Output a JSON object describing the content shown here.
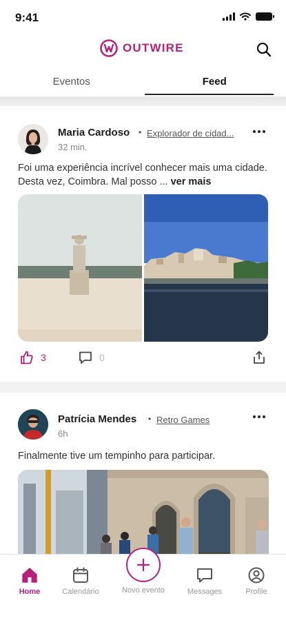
{
  "status_bar": {
    "time": "9:41"
  },
  "header": {
    "logo_text": "OUTWIRE",
    "brand_color": "#b5217a",
    "logo_icon": "outwire-logo-icon",
    "search_icon": "search-icon"
  },
  "tabs": [
    {
      "label": "Eventos",
      "active": false
    },
    {
      "label": "Feed",
      "active": true
    }
  ],
  "feed": {
    "posts": [
      {
        "author": "Maria Cardoso",
        "group": "Explorador de cidad...",
        "time": "32 min.",
        "text": "Foi uma experiência incrível conhecer mais uma cidade. Desta vez, Coimbra. Mal posso ...",
        "see_more": "ver mais",
        "likes": "3",
        "comments": "0",
        "images": [
          "statue-photo",
          "coimbra-city-photo"
        ]
      },
      {
        "author": "Patrícia Mendes",
        "group": "Retro Games",
        "time": "6h",
        "text": "Finalmente tive um tempinho para participar.",
        "images": [
          "stone-building-photo"
        ]
      }
    ]
  },
  "bottom_nav": {
    "items": [
      {
        "label": "Home",
        "icon": "home-icon",
        "active": true
      },
      {
        "label": "Calendário",
        "icon": "calendar-icon",
        "active": false
      },
      {
        "label": "Novo evento",
        "icon": "plus-icon",
        "active": false
      },
      {
        "label": "Messages",
        "icon": "message-icon",
        "active": false
      },
      {
        "label": "Profile",
        "icon": "profile-icon",
        "active": false
      }
    ]
  }
}
